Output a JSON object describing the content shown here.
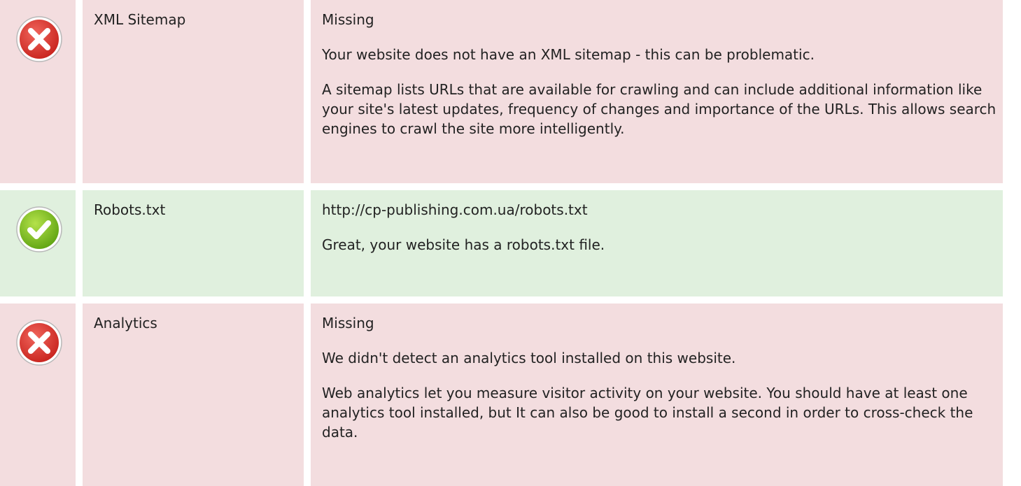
{
  "rows": [
    {
      "status": "error",
      "icon": "error-x-icon",
      "label": "XML Sitemap",
      "value": "Missing",
      "paragraphs": [
        "Your website does not have an XML sitemap - this can be problematic.",
        "A sitemap lists URLs that are available for crawling and can include additional information like your site's latest updates, frequency of changes and importance of the URLs. This allows search engines to crawl the site more intelligently."
      ]
    },
    {
      "status": "success",
      "icon": "success-check-icon",
      "label": "Robots.txt",
      "value": "http://cp-publishing.com.ua/robots.txt",
      "paragraphs": [
        "Great, your website has a robots.txt file."
      ]
    },
    {
      "status": "error",
      "icon": "error-x-icon",
      "label": "Analytics",
      "value": "Missing",
      "paragraphs": [
        "We didn't detect an analytics tool installed on this website.",
        "Web analytics let you measure visitor activity on your website. You should have at least one analytics tool installed, but It can also be good to install a second in order to cross-check the data."
      ]
    }
  ],
  "colors": {
    "error_bg": "#f3dddf",
    "success_bg": "#e0f0de",
    "error_icon": "#d9302a",
    "success_icon": "#7cbf1c"
  }
}
